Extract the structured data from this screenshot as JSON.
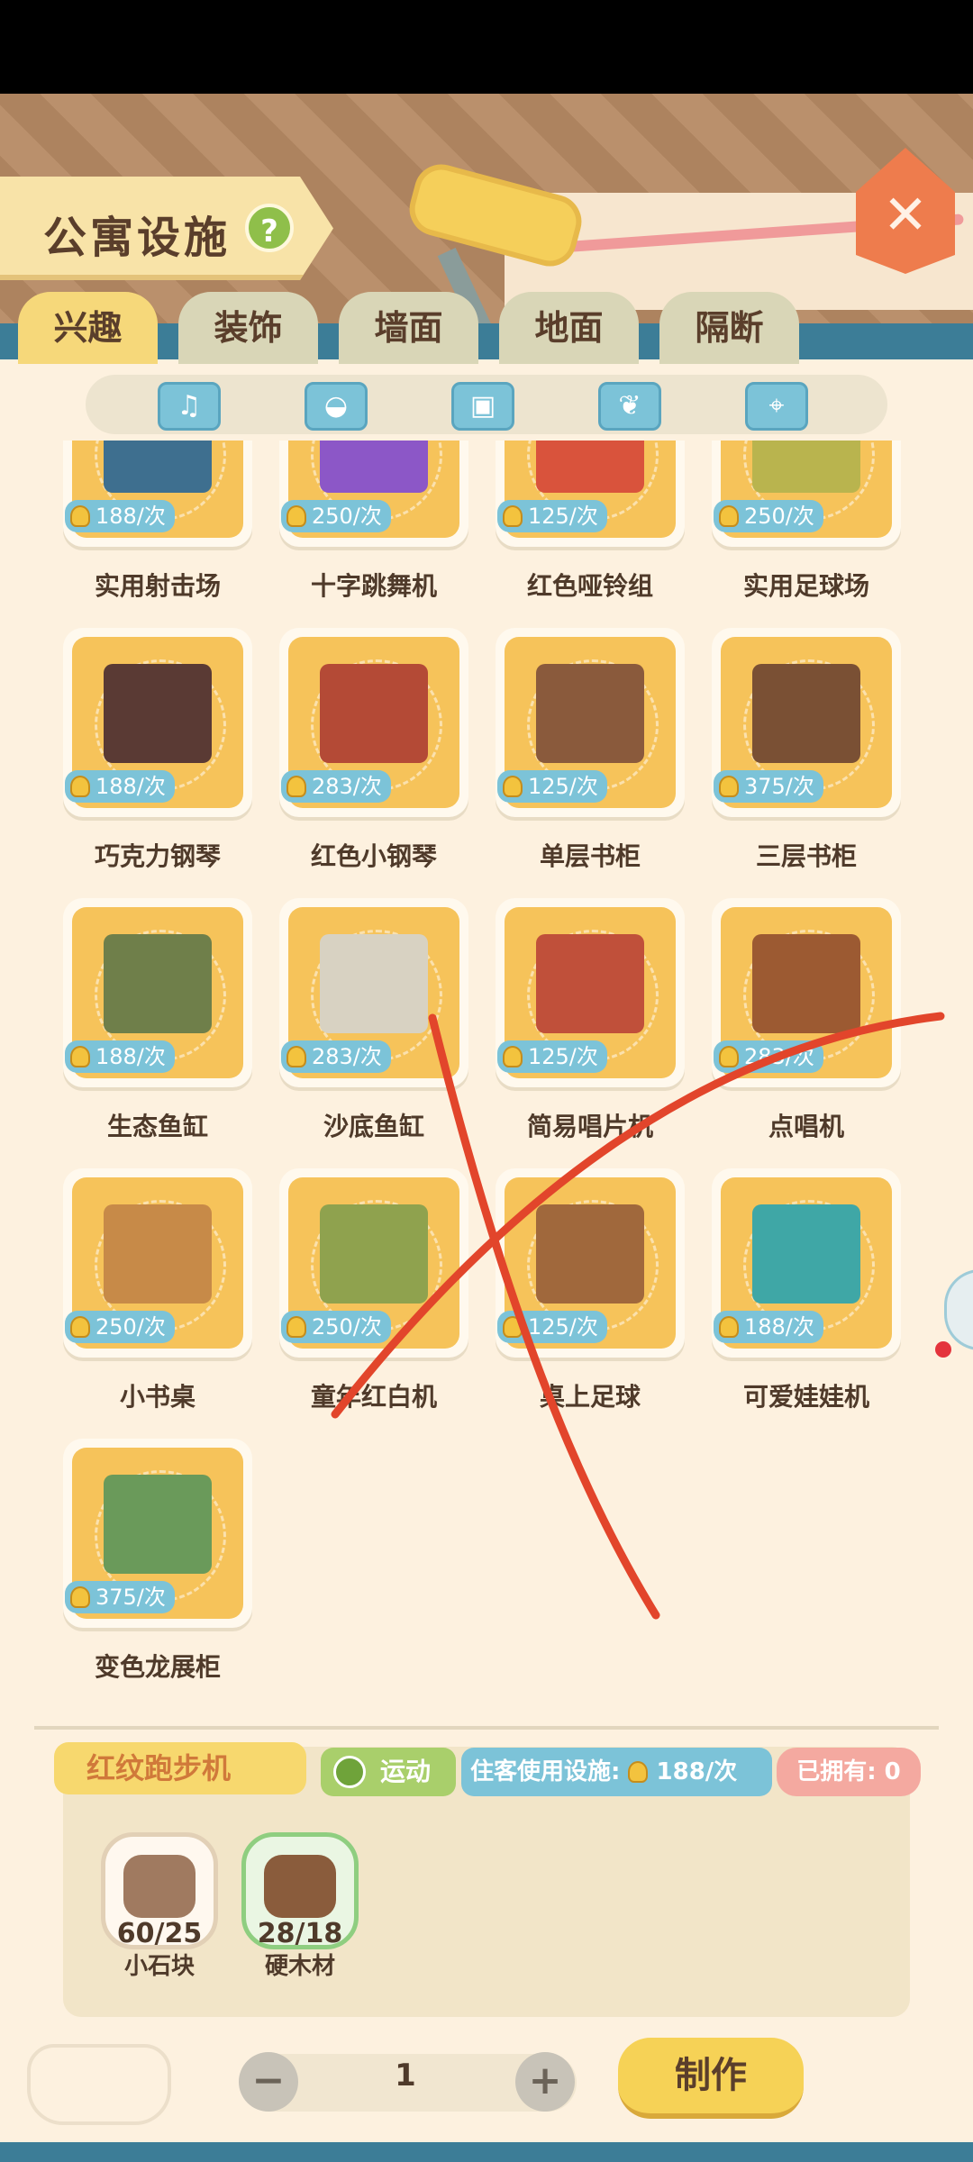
{
  "header": {
    "title": "公寓设施",
    "help": "?",
    "close": "✕"
  },
  "tabs": [
    {
      "label": "兴趣",
      "active": true
    },
    {
      "label": "装饰",
      "active": false
    },
    {
      "label": "墙面",
      "active": false
    },
    {
      "label": "地面",
      "active": false
    },
    {
      "label": "隔断",
      "active": false
    }
  ],
  "filters": [
    {
      "icon": "music-note-icon",
      "glyph": "♫"
    },
    {
      "icon": "tennis-ball-icon",
      "glyph": "◒"
    },
    {
      "icon": "floppy-disk-icon",
      "glyph": "▣"
    },
    {
      "icon": "plant-icon",
      "glyph": "❦"
    },
    {
      "icon": "gamepad-icon",
      "glyph": "⌖"
    }
  ],
  "items": [
    {
      "name": "实用射击场",
      "price": "188/次",
      "thumb_color": "#3e6f8f"
    },
    {
      "name": "十字跳舞机",
      "price": "250/次",
      "thumb_color": "#8c57c7"
    },
    {
      "name": "红色哑铃组",
      "price": "125/次",
      "thumb_color": "#d9533c"
    },
    {
      "name": "实用足球场",
      "price": "250/次",
      "thumb_color": "#b9b44e"
    },
    {
      "name": "巧克力钢琴",
      "price": "188/次",
      "thumb_color": "#5a3a34"
    },
    {
      "name": "红色小钢琴",
      "price": "283/次",
      "thumb_color": "#b44a36"
    },
    {
      "name": "单层书柜",
      "price": "125/次",
      "thumb_color": "#8a5a3c"
    },
    {
      "name": "三层书柜",
      "price": "375/次",
      "thumb_color": "#7a5034"
    },
    {
      "name": "生态鱼缸",
      "price": "188/次",
      "thumb_color": "#6f7f4a"
    },
    {
      "name": "沙底鱼缸",
      "price": "283/次",
      "thumb_color": "#d8d2c2"
    },
    {
      "name": "简易唱片机",
      "price": "125/次",
      "thumb_color": "#c0503a"
    },
    {
      "name": "点唱机",
      "price": "283/次",
      "thumb_color": "#9c5a32"
    },
    {
      "name": "小书桌",
      "price": "250/次",
      "thumb_color": "#c78a48"
    },
    {
      "name": "童年红白机",
      "price": "250/次",
      "thumb_color": "#8fa24e"
    },
    {
      "name": "桌上足球",
      "price": "125/次",
      "thumb_color": "#a0683c"
    },
    {
      "name": "可爱娃娃机",
      "price": "188/次",
      "thumb_color": "#3fa7a6"
    },
    {
      "name": "变色龙展柜",
      "price": "375/次",
      "thumb_color": "#6a9a5a"
    }
  ],
  "selected": {
    "name": "红纹跑步机",
    "category": "运动",
    "usage_label": "住客使用设施:",
    "usage_value": "188/次",
    "owned": "已拥有: 0"
  },
  "materials": [
    {
      "count": "60/25",
      "name": "小石块",
      "sufficient": false
    },
    {
      "count": "28/18",
      "name": "硬木材",
      "sufficient": true
    }
  ],
  "stepper": {
    "minus": "−",
    "value": "1",
    "plus": "+"
  },
  "make_label": "制作"
}
